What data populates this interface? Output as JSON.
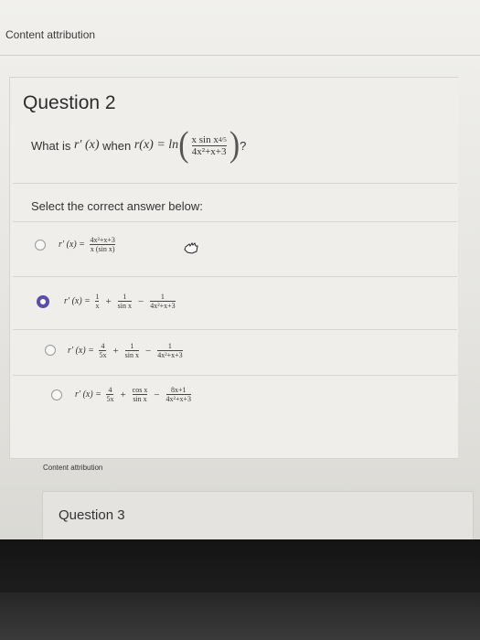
{
  "top_attribution": "Content attribution",
  "question": {
    "title": "Question 2",
    "prompt_prefix": "What is",
    "prompt_when": "when",
    "prompt_suffix": "?",
    "fn_prime": "r′ (x)",
    "fn": "r(x) = ln",
    "frac_num": "x sin x",
    "frac_num_exp": "4/5",
    "frac_den": "4x²+x+3"
  },
  "select_label": "Select the correct answer below:",
  "options": [
    {
      "lhs": "r′ (x) =",
      "num": "4x²+x+3",
      "den": "x (sin x)",
      "selected": false
    },
    {
      "lhs": "r′ (x) =",
      "t1_num": "1",
      "t1_den": "x",
      "t2_num": "1",
      "t2_den": "sin x",
      "t3_num": "1",
      "t3_den": "4x²+x+3",
      "selected": true
    },
    {
      "lhs": "r′ (x) =",
      "t1_num": "4",
      "t1_den": "5x",
      "t2_num": "1",
      "t2_den": "sin x",
      "t3_num": "1",
      "t3_den": "4x²+x+3",
      "selected": false
    },
    {
      "lhs": "r′ (x) =",
      "t1_num": "4",
      "t1_den": "5x",
      "t2_num": "cos x",
      "t2_den": "sin x",
      "t3_num": "8x+1",
      "t3_den": "4x²+x+3",
      "selected": false
    }
  ],
  "footer_attribution": "Content attribution",
  "next_question": {
    "title": "Question 3"
  },
  "colors": {
    "radio_selected": "#5a4eaa",
    "bezel": "#1a1a1a"
  }
}
